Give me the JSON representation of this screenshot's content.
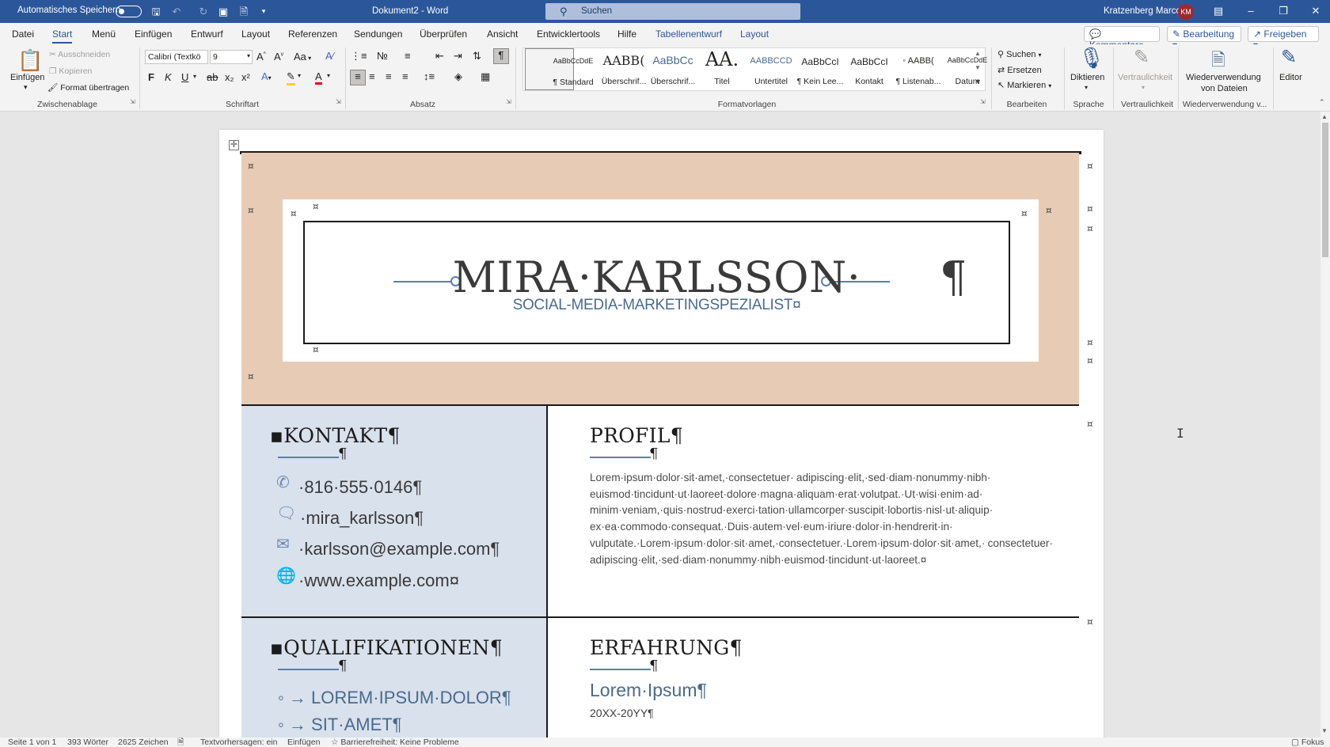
{
  "titlebar": {
    "autosave_label": "Automatisches Speichern",
    "doc_title": "Dokument2  -  Word",
    "search_placeholder": "Suchen",
    "user_name": "Kratzenberg Marco",
    "user_initials": "KM"
  },
  "menu": {
    "tabs": [
      "Datei",
      "Start",
      "Menü",
      "Einfügen",
      "Entwurf",
      "Layout",
      "Referenzen",
      "Sendungen",
      "Überprüfen",
      "Ansicht",
      "Entwicklertools",
      "Hilfe",
      "Tabellenentwurf",
      "Layout"
    ],
    "active_tab": "Start",
    "comments_label": "Kommentare",
    "editing_label": "Bearbeitung",
    "share_label": "Freigeben"
  },
  "ribbon": {
    "clipboard": {
      "paste": "Einfügen",
      "cut": "Ausschneiden",
      "copy": "Kopieren",
      "format_painter": "Format übertragen",
      "group": "Zwischenablage"
    },
    "font": {
      "family": "Calibri (Textkö",
      "size": "9",
      "bold": "F",
      "italic": "K",
      "underline": "U",
      "strike": "ab",
      "subscript": "x₂",
      "superscript": "x²",
      "case": "Aa",
      "group": "Schriftart"
    },
    "paragraph": {
      "group": "Absatz"
    },
    "styles": {
      "items": [
        {
          "preview": "AaBbCcDdE",
          "name": "¶ Standard"
        },
        {
          "preview": "AABB(",
          "name": "Überschrif..."
        },
        {
          "preview": "AaBbCc",
          "name": "Überschrif..."
        },
        {
          "preview": "AA.",
          "name": "Titel"
        },
        {
          "preview": "AABBCCD",
          "name": "Untertitel"
        },
        {
          "preview": "AaBbCcI",
          "name": "¶ Kein Lee..."
        },
        {
          "preview": "AaBbCcI",
          "name": "Kontakt"
        },
        {
          "preview": "◦ AABB(",
          "name": "¶ Listenab..."
        },
        {
          "preview": "AaBbCcDdE",
          "name": "Datum"
        }
      ],
      "group": "Formatvorlagen"
    },
    "editing": {
      "find": "Suchen",
      "replace": "Ersetzen",
      "select": "Markieren",
      "group": "Bearbeiten"
    },
    "voice": {
      "dictate": "Diktieren",
      "group": "Sprache"
    },
    "sensitivity": {
      "label": "Vertraulichkeit",
      "group": "Vertraulichkeit"
    },
    "reuse": {
      "label_line1": "Wiederverwendung",
      "label_line2": "von Dateien",
      "group": "Wiederverwendung v..."
    },
    "editor": {
      "label": "Editor"
    }
  },
  "document": {
    "name": "MIRA·KARLSSON·",
    "subtitle": "SOCIAL-MEDIA-MARKETINGSPEZIALIST¤",
    "contact": {
      "title": "▪KONTAKT¶",
      "phone": "·816·555·0146¶",
      "social": "·mira_karlsson¶",
      "email": "·karlsson@example.com¶",
      "web": "·www.example.com¤"
    },
    "profile": {
      "title": "PROFIL¶",
      "text": "Lorem·ipsum·dolor·sit·amet,·consectetuer· adipiscing·elit,·sed·diam·nonummy·nibh· euismod·tincidunt·ut·laoreet·dolore·magna·aliquam·erat·volutpat.·Ut·wisi·enim·ad· minim·veniam,·quis·nostrud·exerci·tation·ullamcorper·suscipit·lobortis·nisl·ut·aliquip· ex·ea·commodo·consequat.·Duis·autem·vel·eum·iriure·dolor·in·hendrerit·in· vulputate.·Lorem·ipsum·dolor·sit·amet,·consectetuer.·Lorem·ipsum·dolor·sit·amet,· consectetuer· adipiscing·elit,·sed·diam·nonummy·nibh·euismod·tincidunt·ut·laoreet.¤"
    },
    "qualifications": {
      "title": "▪QUALIFIKATIONEN¶",
      "items": [
        "◦ → LOREM·IPSUM·DOLOR¶",
        "◦ → SIT·AMET¶"
      ]
    },
    "experience": {
      "title": "ERFAHRUNG¶",
      "company": "Lorem·Ipsum¶",
      "dates": "20XX-20YY¶"
    },
    "pilcrow": "¶",
    "cell_mark": "¤"
  },
  "status": {
    "page": "Seite 1 von 1",
    "words": "393 Wörter",
    "chars": "2625 Zeichen",
    "predictions": "Textvorhersagen: ein",
    "insert": "Einfügen",
    "accessibility": "Barrierefreiheit: Keine Probleme",
    "focus": "Fokus"
  },
  "colors": {
    "title_bar": "#2b579a",
    "header_band": "#e8cbb5",
    "left_column": "#d8e1ec",
    "accent_blue": "#5e7da8"
  }
}
